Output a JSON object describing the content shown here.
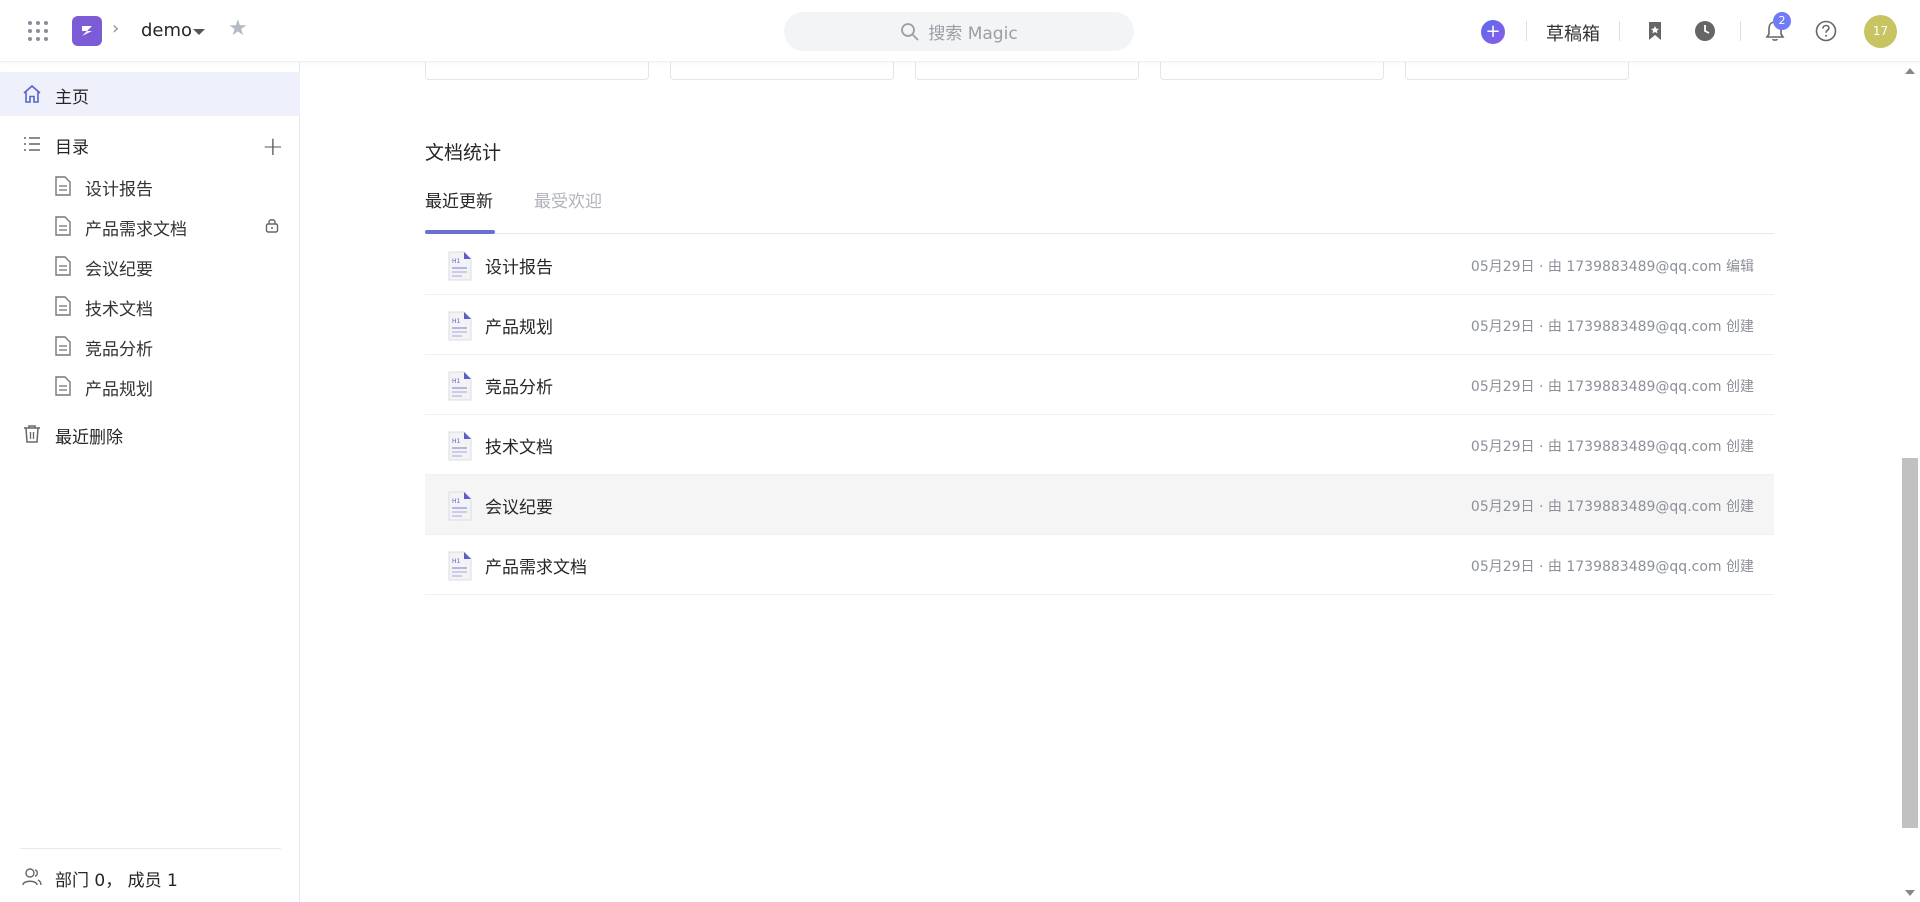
{
  "header": {
    "space_name": "demo",
    "search_placeholder": "搜索 Magic",
    "drafts_label": "草稿箱",
    "notification_count": "2",
    "avatar_text": "17"
  },
  "sidebar": {
    "home_label": "主页",
    "catalog_label": "目录",
    "items": [
      {
        "label": "设计报告"
      },
      {
        "label": "产品需求文档",
        "locked": true
      },
      {
        "label": "会议纪要"
      },
      {
        "label": "技术文档"
      },
      {
        "label": "竞品分析"
      },
      {
        "label": "产品规划"
      }
    ],
    "trash_label": "最近删除",
    "footer_label": "部门 0， 成员 1"
  },
  "main": {
    "section_title": "文档统计",
    "tabs": [
      {
        "label": "最近更新",
        "active": true
      },
      {
        "label": "最受欢迎",
        "active": false
      }
    ],
    "documents": [
      {
        "title": "设计报告",
        "meta": "05月29日 · 由  1739883489@qq.com  编辑"
      },
      {
        "title": "产品规划",
        "meta": "05月29日 · 由  1739883489@qq.com  创建"
      },
      {
        "title": "竞品分析",
        "meta": "05月29日 · 由  1739883489@qq.com  创建"
      },
      {
        "title": "技术文档",
        "meta": "05月29日 · 由  1739883489@qq.com  创建"
      },
      {
        "title": "会议纪要",
        "meta": "05月29日 · 由  1739883489@qq.com  创建"
      },
      {
        "title": "产品需求文档",
        "meta": "05月29日 · 由  1739883489@qq.com  创建"
      }
    ]
  },
  "colors": {
    "accent": "#6a6fd1",
    "logo": "#7b5cd6",
    "avatar": "#c9c463",
    "sidebar_active_bg": "#eef0fb"
  }
}
